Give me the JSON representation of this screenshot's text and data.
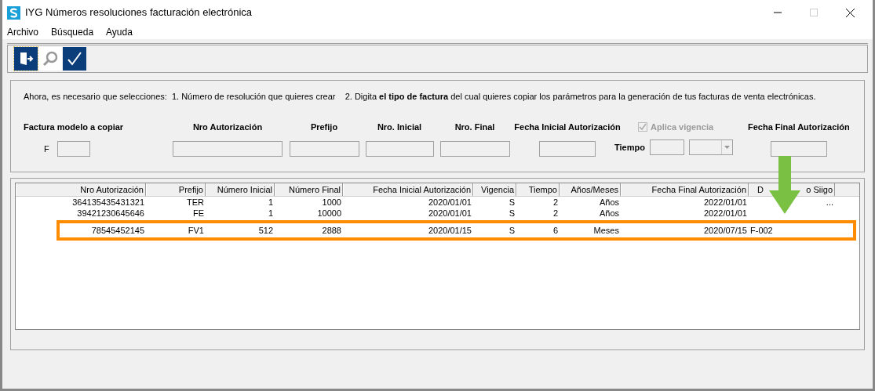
{
  "window": {
    "title": "IYG Números resoluciones facturación electrónica"
  },
  "menu": [
    "Archivo",
    "Búsqueda",
    "Ayuda"
  ],
  "toolbar": [
    {
      "kind": "exit",
      "selected": true
    },
    {
      "kind": "search",
      "selected": false
    },
    {
      "kind": "accept",
      "selected": false
    }
  ],
  "instructions": "Ahora, es necesario que selecciones:  1. Número de resolución que quieres crear    2. Digita **el tipo de factura** del cual quieres copiar los parámetros para la generación de tus facturas de venta electrónicas.",
  "form": {
    "model_label": "Factura modelo a copiar",
    "model_prefix": "F",
    "fields": [
      "Nro Autorización",
      "Prefijo",
      "Nro. Inicial",
      "Nro. Final",
      "Fecha Inicial Autorización"
    ],
    "vigencia": {
      "label": "Aplica vigencia",
      "checked": true,
      "disabled": true
    },
    "tiempo_label": "Tiempo",
    "final_label": "Fecha Final Autorización"
  },
  "table": {
    "columns": [
      "Nro Autorización",
      "Prefijo",
      "Número Inicial",
      "Número Final",
      "Fecha Inicial Autorización",
      "Vigencia",
      "Tiempo",
      "Años/Meses",
      "Fecha Final Autorización",
      [
        "D",
        "o Siigo"
      ]
    ],
    "rows": [
      {
        "cells": [
          "364135435431321",
          "TER",
          "1",
          "1000",
          "2020/01/01",
          "S",
          "2",
          "Años",
          "2022/01/01",
          "..."
        ],
        "highlighted": false
      },
      {
        "cells": [
          "39421230645646",
          "FE",
          "1",
          "10000",
          "2020/01/01",
          "S",
          "2",
          "Años",
          "2022/01/01",
          ""
        ],
        "highlighted": false
      },
      {
        "cells": [
          "78545452145",
          "FV1",
          "512",
          "2888",
          "2020/01/15",
          "S",
          "6",
          "Meses",
          "2020/07/15",
          "F-002"
        ],
        "highlighted": true
      }
    ]
  }
}
